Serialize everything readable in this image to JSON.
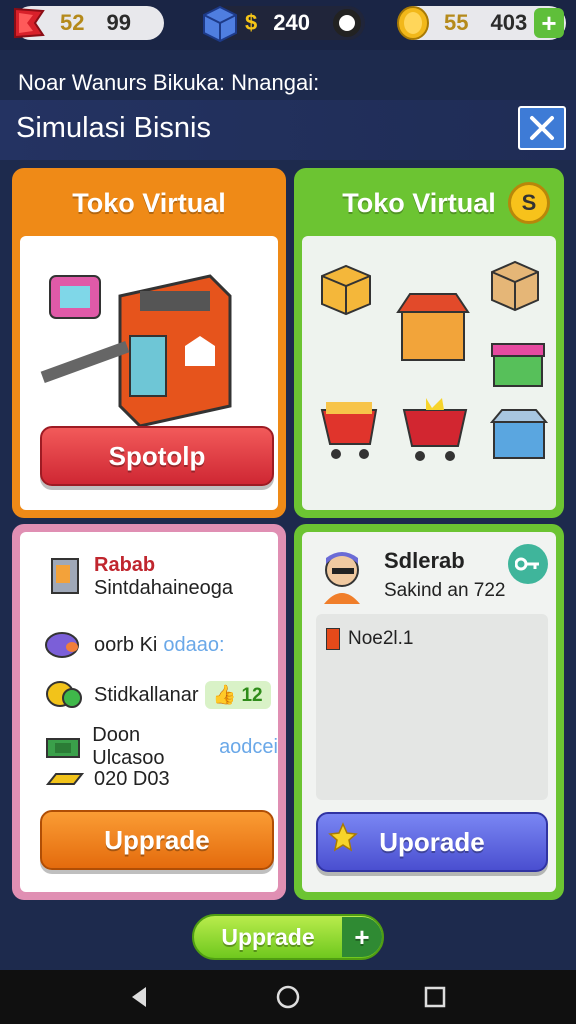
{
  "topbar": {
    "health": {
      "icon": "red-flag-icon",
      "value_a": "52",
      "value_b": "99"
    },
    "cash": {
      "icon": "blue-crate-icon",
      "symbol": "$",
      "value": "240",
      "extra_icon": "settings-icon"
    },
    "coins": {
      "icon": "gold-coin-icon",
      "value_a": "55",
      "value_b": "403",
      "add_label": "+"
    }
  },
  "subtitle": "Noar Wanurs Bikuka: Nnangai:",
  "page_title": "Simulasi Bisnis",
  "close_label": "✕",
  "card_tl": {
    "title": "Toko Virtual",
    "button": "Spotolp"
  },
  "card_tr": {
    "title": "Toko Virtual",
    "badge": "S"
  },
  "card_bl": {
    "rows": [
      {
        "icon": "machine-icon",
        "title": "Rabab",
        "text": "Sintdahaineoga"
      },
      {
        "icon": "donut-icon",
        "text": "oorb Ki",
        "hint": "odaao:"
      },
      {
        "icon": "coin-stack-icon",
        "text": "Stidkallanar",
        "badge": "12",
        "badge_icon": "thumb-icon"
      },
      {
        "icon": "cash-bundle-icon",
        "text": "Doon Ulcasoo",
        "hint": "aodcei"
      },
      {
        "icon": "gold-bar-icon",
        "text": "020 D03"
      }
    ],
    "button": "Upprade"
  },
  "card_br": {
    "user_name": "Sdlerab",
    "user_text": "Sakind an 722",
    "item": "Noe2l.1",
    "button": "Uporade"
  },
  "bottom": {
    "upgrade": "Upprade",
    "plus": "+"
  },
  "colors": {
    "bg": "#1d2a4d",
    "orange": "#ef8a17",
    "green": "#6cc432",
    "pink": "#e08fb3",
    "red_btn": "#cf2733",
    "blue_btn": "#4a4fd0"
  }
}
